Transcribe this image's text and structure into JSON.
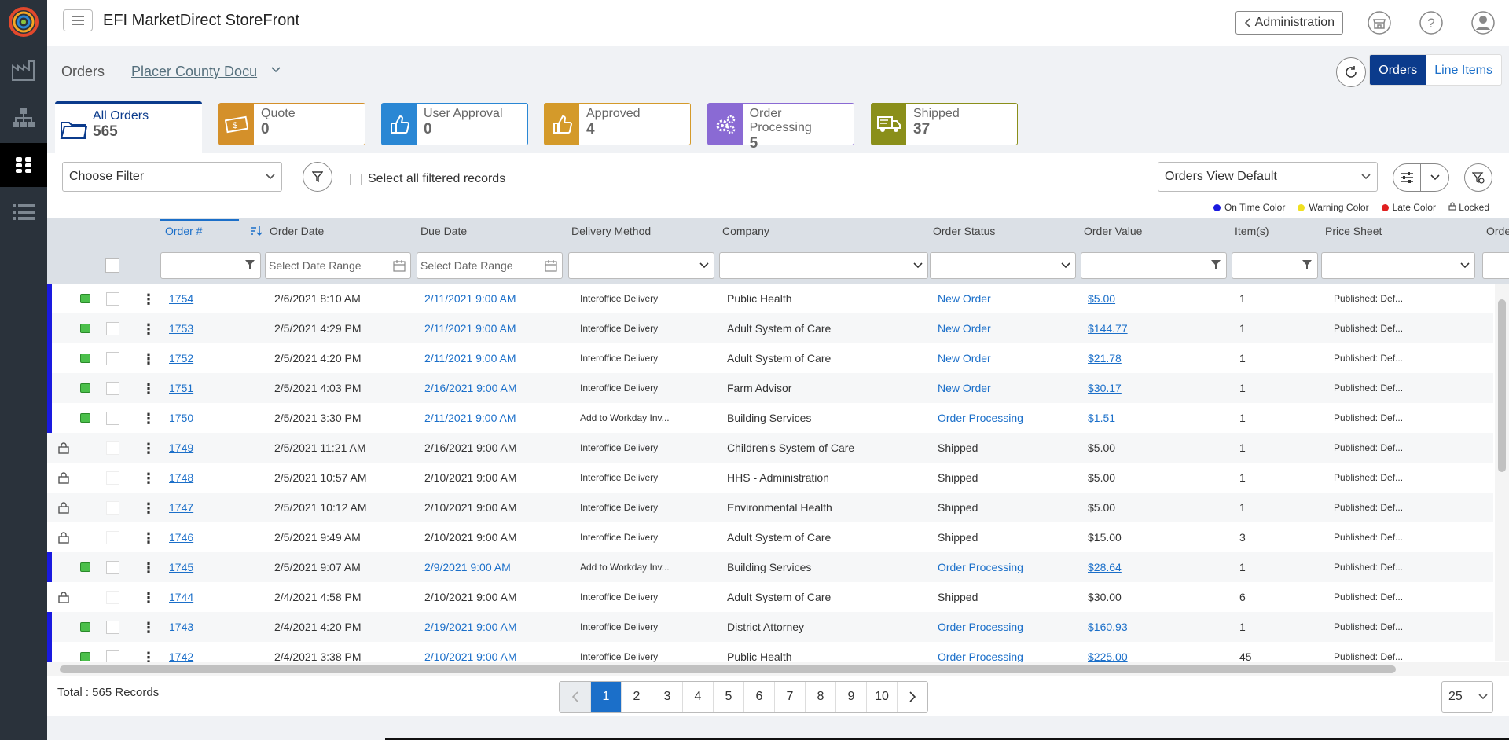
{
  "app": {
    "title": "EFI MarketDirect StoreFront"
  },
  "topbar": {
    "admin_label": "Administration"
  },
  "breadcrumb": {
    "section": "Orders",
    "store": "Placer County Docu"
  },
  "view_toggle": {
    "orders": "Orders",
    "line_items": "Line Items"
  },
  "tiles": {
    "all": {
      "label": "All Orders",
      "count": "565"
    },
    "quote": {
      "label": "Quote",
      "count": "0",
      "color": "#d4902a"
    },
    "user_approval": {
      "label": "User Approval",
      "count": "0",
      "color": "#2a87d4"
    },
    "approved": {
      "label": "Approved",
      "count": "4",
      "color": "#d49a2a"
    },
    "order_processing": {
      "label": "Order Processing",
      "count": "5",
      "color": "#8a6ad4"
    },
    "shipped": {
      "label": "Shipped",
      "count": "37",
      "color": "#8a8f1a"
    }
  },
  "filters": {
    "choose_filter": "Choose Filter",
    "select_all": "Select all filtered records",
    "view": "Orders View Default",
    "date_placeholder": "Select Date Range"
  },
  "legend": {
    "on_time": "On Time Color",
    "warning": "Warning Color",
    "late": "Late Color",
    "locked": "Locked"
  },
  "columns": [
    "Order #",
    "Order Date",
    "Due Date",
    "Delivery Method",
    "Company",
    "Order Status",
    "Order Value",
    "Item(s)",
    "Price Sheet",
    "Orde"
  ],
  "rows": [
    {
      "order": "1754",
      "date": "2/6/2021 8:10 AM",
      "due": "2/11/2021 9:00 AM",
      "method": "Interoffice Delivery",
      "company": "Public Health",
      "status": "New Order",
      "value": "$5.00",
      "items": "1",
      "price": "Published: Def...",
      "locked": false
    },
    {
      "order": "1753",
      "date": "2/5/2021 4:29 PM",
      "due": "2/11/2021 9:00 AM",
      "method": "Interoffice Delivery",
      "company": "Adult System of Care",
      "status": "New Order",
      "value": "$144.77",
      "items": "1",
      "price": "Published: Def...",
      "locked": false
    },
    {
      "order": "1752",
      "date": "2/5/2021 4:20 PM",
      "due": "2/11/2021 9:00 AM",
      "method": "Interoffice Delivery",
      "company": "Adult System of Care",
      "status": "New Order",
      "value": "$21.78",
      "items": "1",
      "price": "Published: Def...",
      "locked": false
    },
    {
      "order": "1751",
      "date": "2/5/2021 4:03 PM",
      "due": "2/16/2021 9:00 AM",
      "method": "Interoffice Delivery",
      "company": "Farm Advisor",
      "status": "New Order",
      "value": "$30.17",
      "items": "1",
      "price": "Published: Def...",
      "locked": false
    },
    {
      "order": "1750",
      "date": "2/5/2021 3:30 PM",
      "due": "2/11/2021 9:00 AM",
      "method": "Add to Workday Inv...",
      "company": "Building Services",
      "status": "Order Processing",
      "value": "$1.51",
      "items": "1",
      "price": "Published: Def...",
      "locked": false
    },
    {
      "order": "1749",
      "date": "2/5/2021 11:21 AM",
      "due": "2/16/2021 9:00 AM",
      "method": "Interoffice Delivery",
      "company": "Children's System of Care",
      "status": "Shipped",
      "value": "$5.00",
      "items": "1",
      "price": "Published: Def...",
      "locked": true
    },
    {
      "order": "1748",
      "date": "2/5/2021 10:57 AM",
      "due": "2/10/2021 9:00 AM",
      "method": "Interoffice Delivery",
      "company": "HHS - Administration",
      "status": "Shipped",
      "value": "$5.00",
      "items": "1",
      "price": "Published: Def...",
      "locked": true
    },
    {
      "order": "1747",
      "date": "2/5/2021 10:12 AM",
      "due": "2/10/2021 9:00 AM",
      "method": "Interoffice Delivery",
      "company": "Environmental Health",
      "status": "Shipped",
      "value": "$5.00",
      "items": "1",
      "price": "Published: Def...",
      "locked": true
    },
    {
      "order": "1746",
      "date": "2/5/2021 9:49 AM",
      "due": "2/10/2021 9:00 AM",
      "method": "Interoffice Delivery",
      "company": "Adult System of Care",
      "status": "Shipped",
      "value": "$15.00",
      "items": "3",
      "price": "Published: Def...",
      "locked": true
    },
    {
      "order": "1745",
      "date": "2/5/2021 9:07 AM",
      "due": "2/9/2021 9:00 AM",
      "method": "Add to Workday Inv...",
      "company": "Building Services",
      "status": "Order Processing",
      "value": "$28.64",
      "items": "1",
      "price": "Published: Def...",
      "locked": false
    },
    {
      "order": "1744",
      "date": "2/4/2021 4:58 PM",
      "due": "2/10/2021 9:00 AM",
      "method": "Interoffice Delivery",
      "company": "Adult System of Care",
      "status": "Shipped",
      "value": "$30.00",
      "items": "6",
      "price": "Published: Def...",
      "locked": true
    },
    {
      "order": "1743",
      "date": "2/4/2021 4:20 PM",
      "due": "2/19/2021 9:00 AM",
      "method": "Interoffice Delivery",
      "company": "District Attorney",
      "status": "Order Processing",
      "value": "$160.93",
      "items": "1",
      "price": "Published: Def...",
      "locked": false
    },
    {
      "order": "1742",
      "date": "2/4/2021 3:38 PM",
      "due": "2/10/2021 9:00 AM",
      "method": "Interoffice Delivery",
      "company": "Public Health",
      "status": "Order Processing",
      "value": "$225.00",
      "items": "45",
      "price": "Published: Def...",
      "locked": false
    }
  ],
  "footer": {
    "total": "Total : 565 Records",
    "pages": [
      "1",
      "2",
      "3",
      "4",
      "5",
      "6",
      "7",
      "8",
      "9",
      "10"
    ],
    "page_size": "25"
  }
}
